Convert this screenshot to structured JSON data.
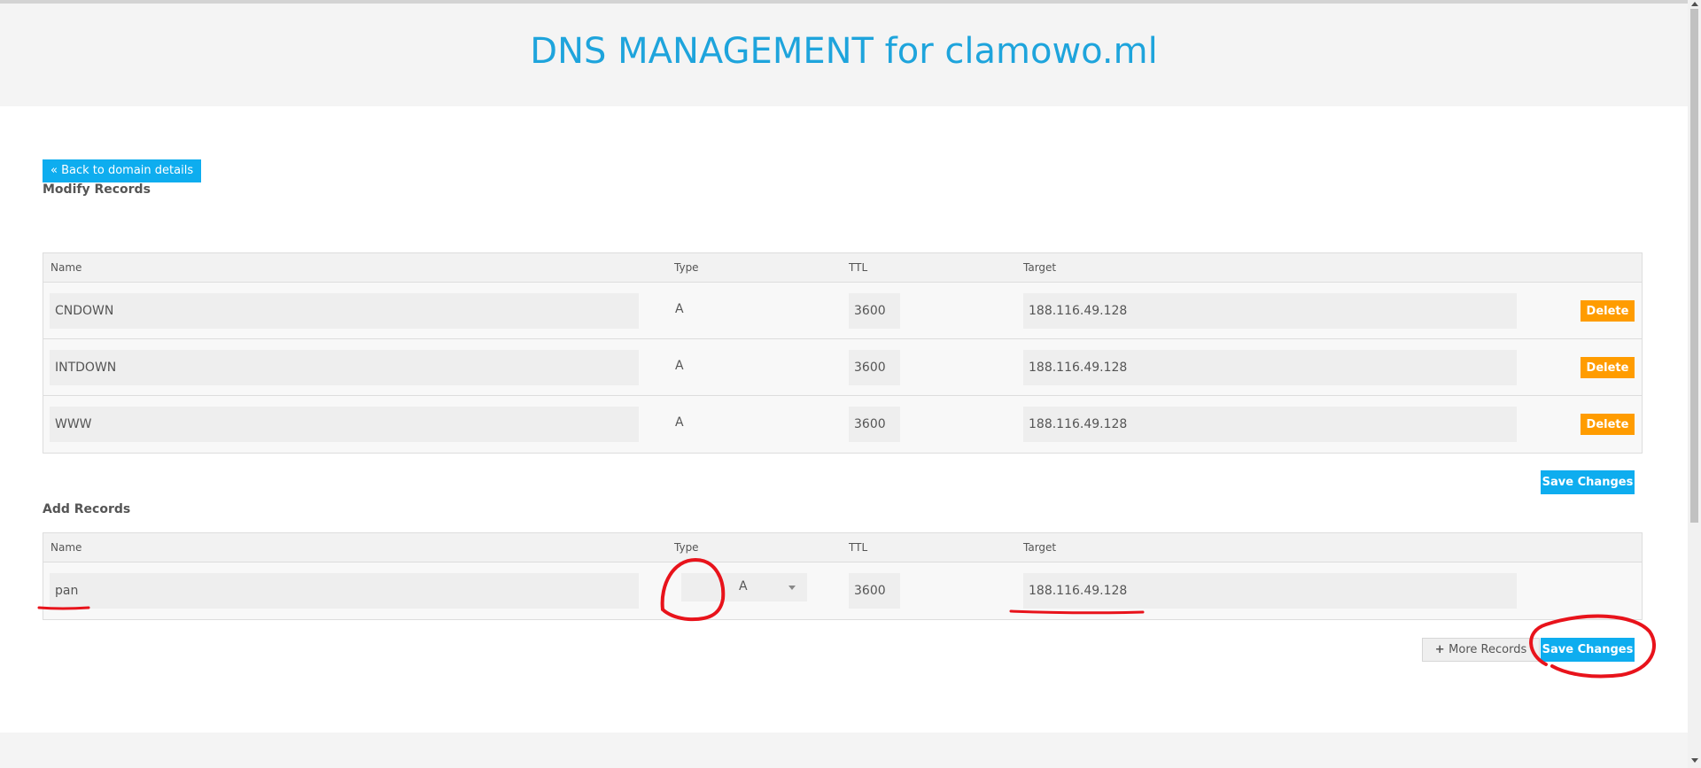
{
  "header": {
    "title": "DNS MANAGEMENT for clamowo.ml"
  },
  "back_button": {
    "label": "« Back to domain details"
  },
  "modify": {
    "title": "Modify Records",
    "columns": {
      "name": "Name",
      "type": "Type",
      "ttl": "TTL",
      "target": "Target"
    },
    "rows": [
      {
        "name": "CNDOWN",
        "type": "A",
        "ttl": "3600",
        "target": "188.116.49.128",
        "delete_label": "Delete"
      },
      {
        "name": "INTDOWN",
        "type": "A",
        "ttl": "3600",
        "target": "188.116.49.128",
        "delete_label": "Delete"
      },
      {
        "name": "WWW",
        "type": "A",
        "ttl": "3600",
        "target": "188.116.49.128",
        "delete_label": "Delete"
      }
    ],
    "save_label": "Save Changes"
  },
  "add": {
    "title": "Add Records",
    "columns": {
      "name": "Name",
      "type": "Type",
      "ttl": "TTL",
      "target": "Target"
    },
    "row": {
      "name": "pan",
      "type": "A",
      "ttl": "3600",
      "target": "188.116.49.128"
    },
    "more_label": "More Records",
    "save_label": "Save Changes"
  },
  "colors": {
    "accent": "#0eadef",
    "title": "#1ea4dc",
    "delete": "#ff9c00",
    "annotation": "#e8131b"
  },
  "icons": {
    "more": "plus-icon",
    "type_dropdown": "caret-down-icon"
  }
}
